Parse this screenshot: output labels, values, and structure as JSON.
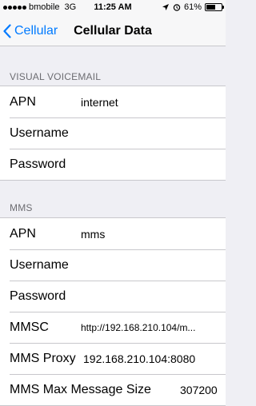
{
  "status_bar": {
    "carrier": "bmobile",
    "network": "3G",
    "time": "11:25 AM",
    "battery_text": "61%",
    "battery_level": 0.61,
    "location_icon": "location-arrow-icon",
    "alarm_icon": "alarm-clock-icon"
  },
  "nav": {
    "back_label": "Cellular",
    "title": "Cellular Data"
  },
  "visual_voicemail": {
    "header": "VISUAL VOICEMAIL",
    "rows": [
      {
        "label": "APN",
        "value": "internet"
      },
      {
        "label": "Username",
        "value": ""
      },
      {
        "label": "Password",
        "value": ""
      }
    ]
  },
  "mms": {
    "header": "MMS",
    "rows": [
      {
        "label": "APN",
        "value": "mms"
      },
      {
        "label": "Username",
        "value": ""
      },
      {
        "label": "Password",
        "value": ""
      },
      {
        "label": "MMSC",
        "value": "http://192.168.210.104/m..."
      },
      {
        "label": "MMS Proxy",
        "value": "192.168.210.104:8080"
      },
      {
        "label": "MMS Max Message Size",
        "value": "307200"
      }
    ]
  },
  "colors": {
    "accent": "#007aff",
    "background": "#efeff4",
    "separator": "#c8c7cc",
    "section_text": "#6d6d72"
  }
}
